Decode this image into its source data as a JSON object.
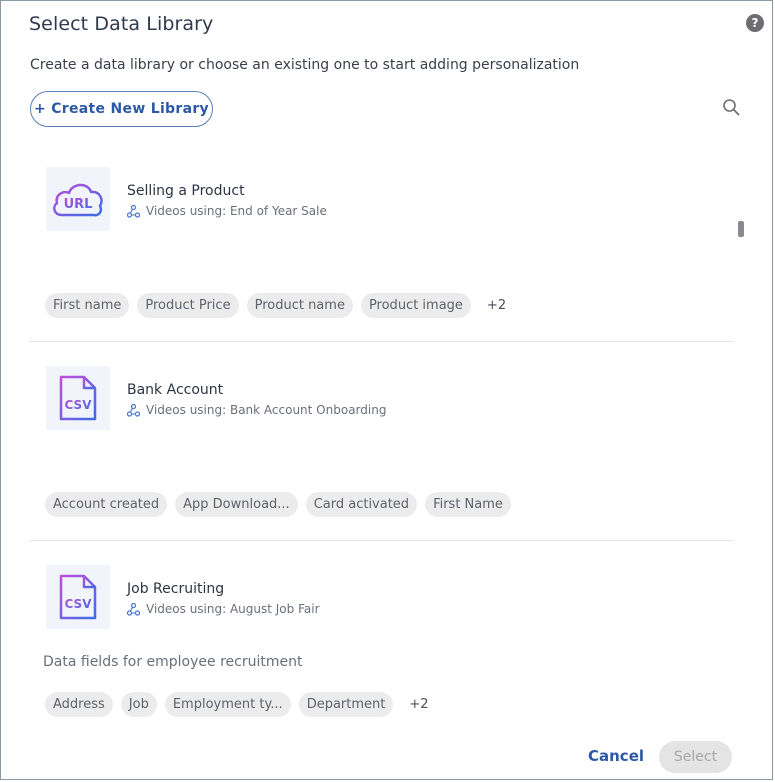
{
  "dialog": {
    "title": "Select Data Library",
    "help_glyph": "?",
    "subtitle": "Create a data library or choose an existing one to start adding personalization",
    "create_button_label": "+ Create New Library"
  },
  "libraries": [
    {
      "name": "Selling a Product",
      "icon": "url-cloud-icon",
      "icon_text": "URL",
      "usage": "Videos using: End of Year Sale",
      "description": "",
      "tags": [
        "First name",
        "Product Price",
        "Product name",
        "Product image"
      ],
      "more": "+2"
    },
    {
      "name": "Bank Account",
      "icon": "csv-file-icon",
      "icon_text": "CSV",
      "usage": "Videos using: Bank Account Onboarding",
      "description": "",
      "tags": [
        "Account created",
        "App Download...",
        "Card activated",
        "First Name"
      ],
      "more": ""
    },
    {
      "name": "Job Recruiting",
      "icon": "csv-file-icon",
      "icon_text": "CSV",
      "usage": "Videos using: August Job Fair",
      "description": "Data fields for employee recruitment",
      "tags": [
        "Address",
        "Job",
        "Employment ty...",
        "Department"
      ],
      "more": "+2"
    }
  ],
  "footer": {
    "cancel_label": "Cancel",
    "select_label": "Select"
  },
  "colors": {
    "accent": "#2c59a6",
    "icon_gradient_start": "#c04fd8",
    "icon_gradient_end": "#3a6ee8",
    "tag_bg": "#ececec"
  }
}
